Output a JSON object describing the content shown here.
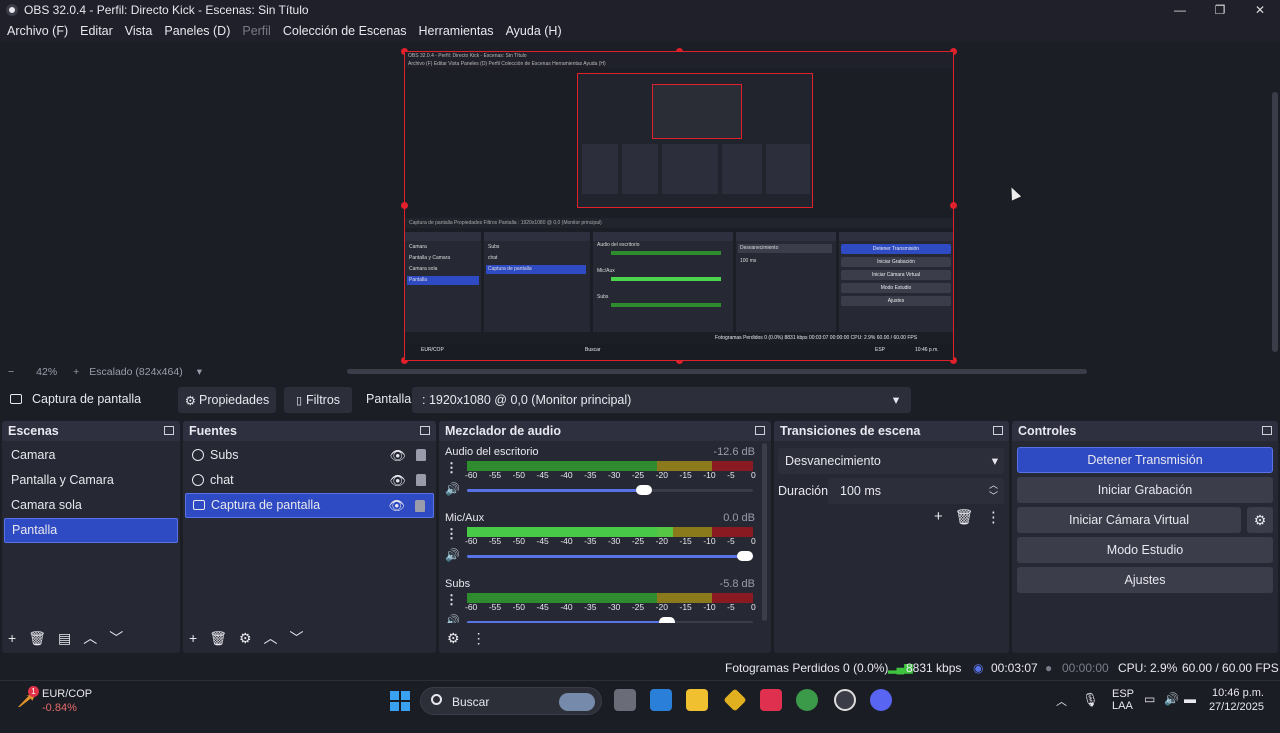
{
  "window": {
    "title": "OBS 32.0.4 - Perfil: Directo Kick - Escenas: Sin Título",
    "controls": [
      "—",
      "❐",
      "✕"
    ]
  },
  "menu": {
    "items": [
      {
        "label": "Archivo (F)",
        "disabled": false
      },
      {
        "label": "Editar",
        "disabled": false
      },
      {
        "label": "Vista",
        "disabled": false
      },
      {
        "label": "Paneles (D)",
        "disabled": false
      },
      {
        "label": "Perfil",
        "disabled": true
      },
      {
        "label": "Colección de Escenas",
        "disabled": false
      },
      {
        "label": "Herramientas",
        "disabled": false
      },
      {
        "label": "Ayuda (H)",
        "disabled": false
      }
    ]
  },
  "preview": {
    "zoom_minus": "−",
    "zoom_value": "42%",
    "zoom_plus": "+",
    "scaling": "Escalado (824x464)",
    "scaling_arrow": "▾",
    "mini_title": "OBS 32.0.4 - Perfil: Directo Kick - Escenas: Sin Título",
    "mini_menu": "Archivo (F)   Editar   Vista   Paneles (D)   Perfil   Colección de Escenas   Herramientas   Ayuda (H)",
    "mini_source_row": "Captura de pantalla      Propiedades     Filtros     Pantalla   : 1920x1080 @ 0,0 (Monitor principal)",
    "mini_panels": {
      "scenes_title": "Escenas",
      "scenes": [
        "Camara",
        "Pantalla y Camara",
        "Camara sola",
        "Pantalla"
      ],
      "sources_title": "Fuentes",
      "sources": [
        "Subs",
        "chat",
        "Captura de pantalla"
      ],
      "mixer_title": "Mezclador de audio",
      "mixer_channels": [
        "Audio del escritorio",
        "Mic/Aux",
        "Subs"
      ],
      "transitions_title": "Transiciones de escena",
      "transition": "Desvanecimiento",
      "duration_label": "Duración",
      "duration": "100 ms",
      "controls_title": "Controles",
      "controls": [
        "Detener Transmisión",
        "Iniciar Grabación",
        "Iniciar Cámara Virtual",
        "Modo Estudio",
        "Ajustes"
      ]
    },
    "mini_taskbar": {
      "ticker": "EUR/COP",
      "search": "Buscar",
      "status": "Fotogramas Perdidos 0 (0.0%)   8831 kbps   00:03:07   00:00:00   CPU: 2.9%   60.00 / 60.00 FPS",
      "lang": "ESP",
      "time": "10:46 p.m."
    }
  },
  "source_toolbar": {
    "source_name": "Captura de pantalla",
    "properties": "Propiedades",
    "filters": "Filtros",
    "display_label": "Pantalla",
    "display_value": ": 1920x1080 @ 0,0 (Monitor principal)",
    "display_arrow": "▾"
  },
  "scenes": {
    "title": "Escenas",
    "items": [
      "Camara",
      "Pantalla y Camara",
      "Camara sola",
      "Pantalla"
    ],
    "selected_index": 3,
    "footer": [
      "+",
      "🗑",
      "▤",
      "︿",
      "﹀"
    ]
  },
  "sources": {
    "title": "Fuentes",
    "items": [
      {
        "name": "Subs",
        "icon": "globe-icon"
      },
      {
        "name": "chat",
        "icon": "globe-icon"
      },
      {
        "name": "Captura de pantalla",
        "icon": "monitor-icon"
      }
    ],
    "selected_index": 2,
    "footer": [
      "+",
      "🗑",
      "⚙",
      "︿",
      "﹀"
    ]
  },
  "mixer": {
    "title": "Mezclador de audio",
    "ticks": [
      "-60",
      "-55",
      "-50",
      "-45",
      "-40",
      "-35",
      "-30",
      "-25",
      "-20",
      "-15",
      "-10",
      "-5",
      "0"
    ],
    "channels": [
      {
        "name": "Audio del escritorio",
        "db": "-12.6 dB",
        "level": 0.0,
        "volume": 0.62
      },
      {
        "name": "Mic/Aux",
        "db": "0.0 dB",
        "level": 0.72,
        "volume": 1.0
      },
      {
        "name": "Subs",
        "db": "-5.8 dB",
        "level": 0.0,
        "volume": 0.7
      }
    ],
    "footer": [
      "⚙",
      "⋮"
    ]
  },
  "transitions": {
    "title": "Transiciones de escena",
    "selected": "Desvanecimiento",
    "duration_label": "Duración",
    "duration": "100 ms",
    "tools": [
      "+",
      "🗑",
      "⋮"
    ]
  },
  "controls": {
    "title": "Controles",
    "stop_stream": "Detener Transmisión",
    "start_recording": "Iniciar Grabación",
    "start_virtual_cam": "Iniciar Cámara Virtual",
    "studio_mode": "Modo Estudio",
    "settings": "Ajustes"
  },
  "status": {
    "dropped_frames": "Fotogramas Perdidos 0 (0.0%)",
    "bitrate": "8831 kbps",
    "stream_time": "00:03:07",
    "record_time": "00:00:00",
    "cpu": "CPU: 2.9%",
    "fps": "60.00 / 60.00 FPS"
  },
  "taskbar": {
    "ticker": "EUR/COP",
    "ticker_change": "-0.84%",
    "badge": "1",
    "search_placeholder": "Buscar",
    "lang_top": "ESP",
    "lang_bottom": "LAA",
    "time": "10:46 p.m.",
    "date": "27/12/2025"
  },
  "colors": {
    "accent": "#2f4bc4",
    "recording_border": "#e0202a",
    "background": "#1c1e26"
  }
}
